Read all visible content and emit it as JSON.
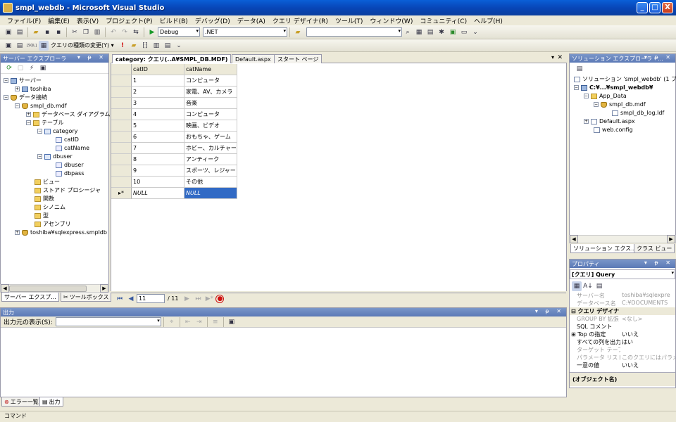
{
  "window": {
    "title": "smpl_webdb - Microsoft Visual Studio",
    "minimize": "_",
    "maximize": "□",
    "close": "X"
  },
  "menu": [
    "ファイル(F)",
    "編集(E)",
    "表示(V)",
    "プロジェクト(P)",
    "ビルド(B)",
    "デバッグ(D)",
    "データ(A)",
    "クエリ デザイナ(R)",
    "ツール(T)",
    "ウィンドウ(W)",
    "コミュニティ(C)",
    "ヘルプ(H)"
  ],
  "toolbar1": {
    "config": "Debug",
    "platform": ".NET",
    "search": ""
  },
  "toolbar2": {
    "change_type": "クエリの種類の変更(Y) ▾",
    "exec_icon": "!",
    "sql_label": "[SQL]"
  },
  "server_explorer": {
    "title": "サーバー エクスプローラ",
    "nodes": [
      "サーバー",
      "toshiba",
      "データ接続",
      "smpl_db.mdf",
      "データベース ダイアグラム",
      "テーブル",
      "category",
      "catID",
      "catName",
      "dbuser",
      "dbuser",
      "dbpass",
      "ビュー",
      "ストアド プロシージャ",
      "関数",
      "シノニム",
      "型",
      "アセンブリ",
      "toshiba¥sqlexpress.smpldb"
    ],
    "tab_server": "サーバー エクスプ...",
    "tab_toolbox": "ツールボックス"
  },
  "editor": {
    "tabs": [
      "category: クエリ(..A¥SMPL_DB.MDF)",
      "Default.aspx",
      "スタート ページ"
    ],
    "columns": [
      "catID",
      "catName"
    ],
    "rows": [
      [
        "1",
        "コンピュータ"
      ],
      [
        "2",
        "家電、AV、カメラ"
      ],
      [
        "3",
        "音楽"
      ],
      [
        "4",
        "コンピュータ"
      ],
      [
        "5",
        "映画、ビデオ"
      ],
      [
        "6",
        "おもちゃ、ゲーム"
      ],
      [
        "7",
        "ホビー、カルチャー"
      ],
      [
        "8",
        "アンティーク"
      ],
      [
        "9",
        "スポーツ、レジャー"
      ],
      [
        "10",
        "その他"
      ]
    ],
    "new_row": [
      "NULL",
      "NULL"
    ],
    "new_row_marker": "▸*",
    "nav": {
      "current": "11",
      "total": "/ 11"
    }
  },
  "solution_explorer": {
    "title": "ソリューション エクスプローラ - ...",
    "nodes": [
      "ソリューション 'smpl_webdb' (1 プロジ",
      "C:¥...¥smpl_webdb¥",
      "App_Data",
      "smpl_db.mdf",
      "smpl_db_log.ldf",
      "Default.aspx",
      "web.config"
    ],
    "tab_solution": "ソリューション エクス...",
    "tab_class": "クラス ビュー"
  },
  "properties": {
    "title": "プロパティ",
    "object": "[クエリ] Query",
    "rows": [
      [
        "サーバー名",
        "toshiba¥sqlexpre"
      ],
      [
        "データベース名",
        "C:¥DOCUMENTS"
      ],
      [
        "クエリ デザイナ",
        ""
      ],
      [
        "GROUP BY 拡張",
        "<なし>"
      ],
      [
        "SQL コメント",
        ""
      ],
      [
        "Top の指定",
        "いいえ"
      ],
      [
        "すべての列を出力",
        "はい"
      ],
      [
        "ターゲット テーブル",
        ""
      ],
      [
        "パラメータ リスト",
        "このクエリにはパラメ"
      ],
      [
        "一意の値",
        "いいえ"
      ]
    ],
    "description": "(オブジェクト名)"
  },
  "output": {
    "title": "出力",
    "show_from_label": "出力元の表示(S):",
    "show_from_value": "",
    "tab_errors": "エラー一覧",
    "tab_output": "出力"
  },
  "statusbar": {
    "text": "コマンド"
  },
  "colors": {
    "titlebar": "#0846b8",
    "chrome": "#ece9d8",
    "panel_header_active": "#5b79b6"
  }
}
